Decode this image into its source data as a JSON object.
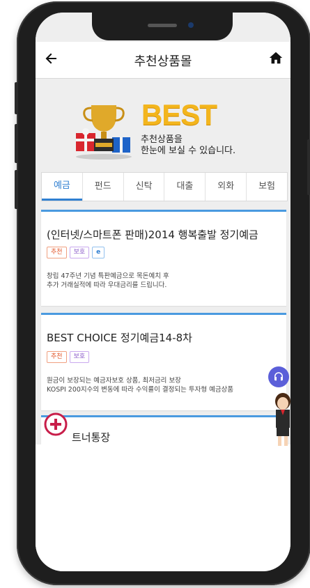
{
  "header": {
    "title": "추천상품몰",
    "back_icon": "arrow-left-icon",
    "home_icon": "home-icon"
  },
  "banner": {
    "best_label": "BEST",
    "subtitle_line1": "추천상품을",
    "subtitle_line2": "한눈에 보실 수 있습니다.",
    "image": "trophy-gift-icon"
  },
  "tabs": [
    {
      "label": "예금",
      "active": true
    },
    {
      "label": "펀드",
      "active": false
    },
    {
      "label": "신탁",
      "active": false
    },
    {
      "label": "대출",
      "active": false
    },
    {
      "label": "외화",
      "active": false
    },
    {
      "label": "보험",
      "active": false
    }
  ],
  "products": [
    {
      "title": "(인터넷/스마트폰 판매)2014 행복출발 정기예금",
      "badges": [
        "추천",
        "보호",
        "e"
      ],
      "desc_line1": "창립 47주년 기념 특판예금으로 목돈예치 후",
      "desc_line2": "추가 거래실적에 따라 우대금리를 드립니다."
    },
    {
      "title": "BEST CHOICE 정기예금14-8차",
      "badges": [
        "추천",
        "보호"
      ],
      "desc_line1": "원금이 보장되는 예금자보호 상품, 최저금리 보장",
      "desc_line2": "KOSPI 200지수의 변동에 따라 수익률이 결정되는 투자형 예금상품"
    },
    {
      "title": "트너통장",
      "badges": [],
      "desc_line1": "",
      "desc_line2": ""
    }
  ],
  "floating": {
    "headset_icon": "headset-icon",
    "mascot": "mascot-icon",
    "plus_icon": "plus-icon"
  },
  "colors": {
    "accent": "#2f7fd1",
    "best_gold": "#f3b51d",
    "recommend": "#e2572a",
    "protect": "#8a5ac8",
    "plus_red": "#c81e4a",
    "headset_bg": "#5b5fd9"
  }
}
